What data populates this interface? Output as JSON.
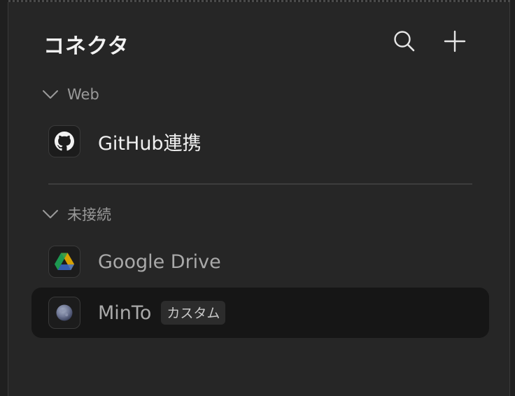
{
  "header": {
    "title": "コネクタ",
    "search_icon": "search-icon",
    "add_icon": "plus-icon"
  },
  "sections": [
    {
      "label": "Web",
      "expanded": true,
      "items": [
        {
          "label": "GitHub連携",
          "icon": "github-icon",
          "connected": true
        }
      ]
    },
    {
      "label": "未接続",
      "expanded": true,
      "items": [
        {
          "label": "Google Drive",
          "icon": "google-drive-icon",
          "connected": false
        },
        {
          "label": "MinTo",
          "icon": "globe-icon",
          "connected": false,
          "badge": "カスタム",
          "selected": true
        }
      ]
    }
  ],
  "colors": {
    "panel_bg": "#262626",
    "selected_row_bg": "#161616",
    "text_primary": "#f0f0f0",
    "text_muted": "#a9a9a9",
    "divider": "#3d3d3d"
  }
}
